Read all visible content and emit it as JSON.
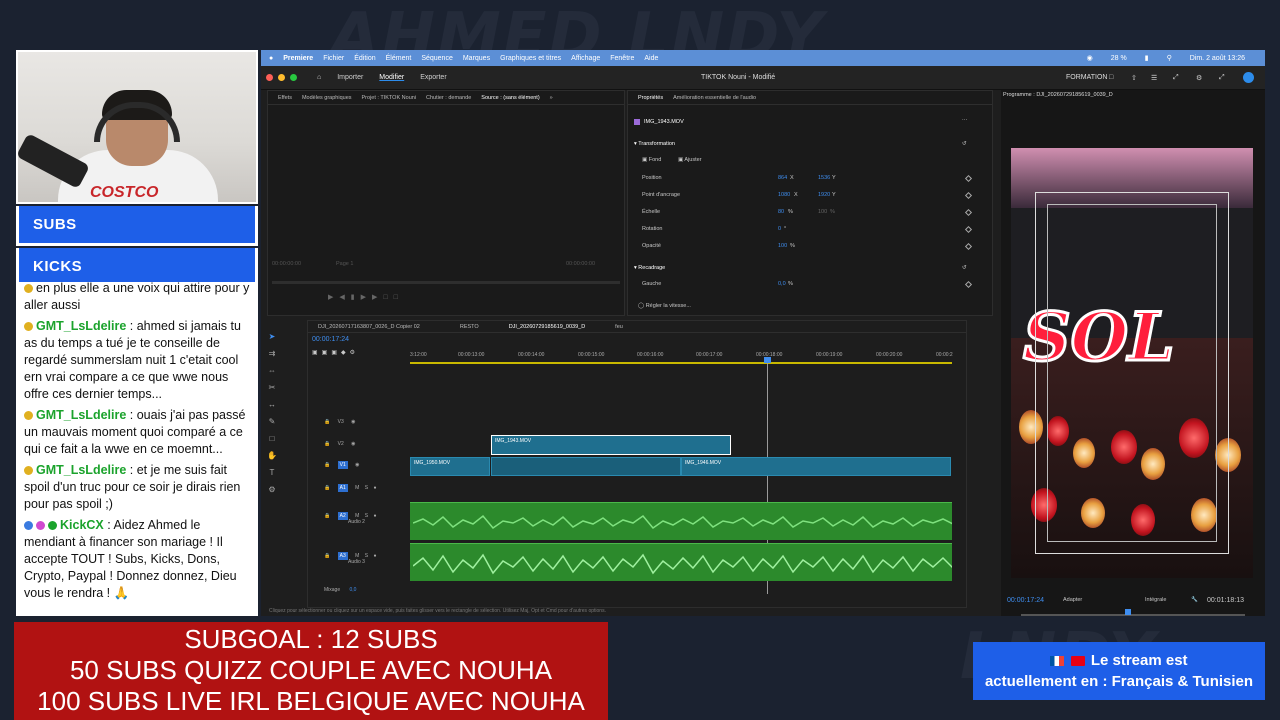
{
  "webcam": {
    "shirt_text": "COSTCO",
    "mic_label": "pla"
  },
  "nav": {
    "subs_label": "SUBS",
    "kicks_label": "KICKS"
  },
  "chat": {
    "messages": [
      {
        "user": "",
        "text": "en plus elle a une voix qui attire pour y aller aussi"
      },
      {
        "user": "GMT_LsLdelire",
        "sep": " : ",
        "text": "ahmed si jamais tu as du temps a tué je te conseille de regardé summerslam nuit 1 c'etait cool ern vrai compare a ce que wwe nous offre ces dernier temps..."
      },
      {
        "user": "GMT_LsLdelire",
        "sep": " : ",
        "text": "ouais j'ai pas passé un mauvais moment quoi comparé a ce qui ce fait a la wwe en ce moemnt..."
      },
      {
        "user": "GMT_LsLdelire",
        "sep": " : ",
        "text": "et je me suis fait spoil d'un truc pour ce soir je dirais rien pour pas spoil ;)"
      },
      {
        "user": "KickCX",
        "sep": " : ",
        "text": "Aidez Ahmed le mendiant à financer son mariage ! Il accepte TOUT ! Subs, Kicks, Dons, Crypto, Paypal ! Donnez donnez, Dieu vous le rendra ! 🙏"
      }
    ]
  },
  "macbar": {
    "menus": [
      "Premiere",
      "Fichier",
      "Édition",
      "Élément",
      "Séquence",
      "Marques",
      "Graphiques et titres",
      "Affichage",
      "Fenêtre",
      "Aide"
    ],
    "battery": "28 %",
    "datetime": "Dim. 2 août 13:26"
  },
  "premiere": {
    "nav_tabs": [
      "Importer",
      "Modifier",
      "Exporter"
    ],
    "active_tab": "Modifier",
    "title": "TIKTOK Nouni - Modifié",
    "workspace": "FORMATION",
    "source_tabs": [
      "Effets",
      "Modèles graphiques",
      "Projet : TIKTOK Nouni",
      "Chutier : demande",
      "Source : (sans élément)"
    ],
    "source_time_left": "00:00:00:00",
    "source_time_right": "00:00:00:00",
    "source_page": "Page 1",
    "props_tabs": [
      "Propriétés",
      "Amélioration essentielle de l'audio"
    ],
    "clip_name": "IMG_1943.MOV",
    "transform_label": "Transformation",
    "fill_label": "Fond",
    "fit_label": "Ajuster",
    "props": [
      {
        "label": "Position",
        "v1": "864",
        "u1": "X",
        "v2": "1536",
        "u2": "Y"
      },
      {
        "label": "Point d'ancrage",
        "v1": "1080",
        "u1": "X",
        "v2": "1920",
        "u2": "Y"
      },
      {
        "label": "Échelle",
        "v1": "80",
        "u1": "%",
        "v2": "100",
        "u2": "%"
      },
      {
        "label": "Rotation",
        "v1": "0",
        "u1": "°",
        "v2": "",
        "u2": ""
      },
      {
        "label": "Opacité",
        "v1": "100",
        "u1": "%",
        "v2": "",
        "u2": ""
      }
    ],
    "crop_label": "Recadrage",
    "crop_left_label": "Gauche",
    "crop_left_value": "0,0",
    "crop_left_unit": "%",
    "speed_label": "Régler la vitesse...",
    "seq_tabs": [
      "DJI_20260717163807_0026_D Copier 02",
      "RESTO",
      "DJI_20260729185619_0039_D",
      "feu"
    ],
    "timecode": "00:00:17:24",
    "ruler": [
      "3:12:00",
      "00:00:13:00",
      "00:00:14:00",
      "00:00:15:00",
      "00:00:16:00",
      "00:00:17:00",
      "00:00:18:00",
      "00:00:19:00",
      "00:00:20:00",
      "00:00:2"
    ],
    "tracks_video": [
      "V3",
      "V2",
      "V1"
    ],
    "tracks_audio": [
      "A1",
      "A2",
      "A3"
    ],
    "audio_names": [
      "",
      "Audio 2",
      "Audio 3"
    ],
    "mix_label": "Mixage",
    "mix_value": "0,0",
    "clips": {
      "v2": "IMG_1943.MOV",
      "v1a": "IMG_1950.MOV",
      "v1b": "IMG_1946.MOV"
    },
    "status_bar": "Cliquez pour sélectionner ou cliquez sur un espace vide, puis faites glisser vers le rectangle de sélection. Utilisez Maj, Opt et Cmd pour d'autres options.",
    "program_title": "Programme : DJI_20260729185619_0039_D",
    "program_time": "00:00:17:24",
    "program_fit": "Adapter",
    "program_quality": "Intégrale",
    "program_duration": "00:01:18:13",
    "sign_text": "SOL"
  },
  "banner_left": {
    "line1": "SUBGOAL : 12 SUBS",
    "line2": "50 SUBS QUIZZ COUPLE AVEC NOUHA",
    "line3": "100 SUBS LIVE IRL BELGIQUE AVEC NOUHA"
  },
  "banner_right": {
    "line1": "Le stream est",
    "line2": "actuellement en : Français & Tunisien"
  },
  "colors": {
    "accent_blue": "#1e5fe8",
    "banner_red": "#b11212",
    "chat_user_green": "#1ba32c",
    "premiere_blue": "#3f8ef0"
  }
}
